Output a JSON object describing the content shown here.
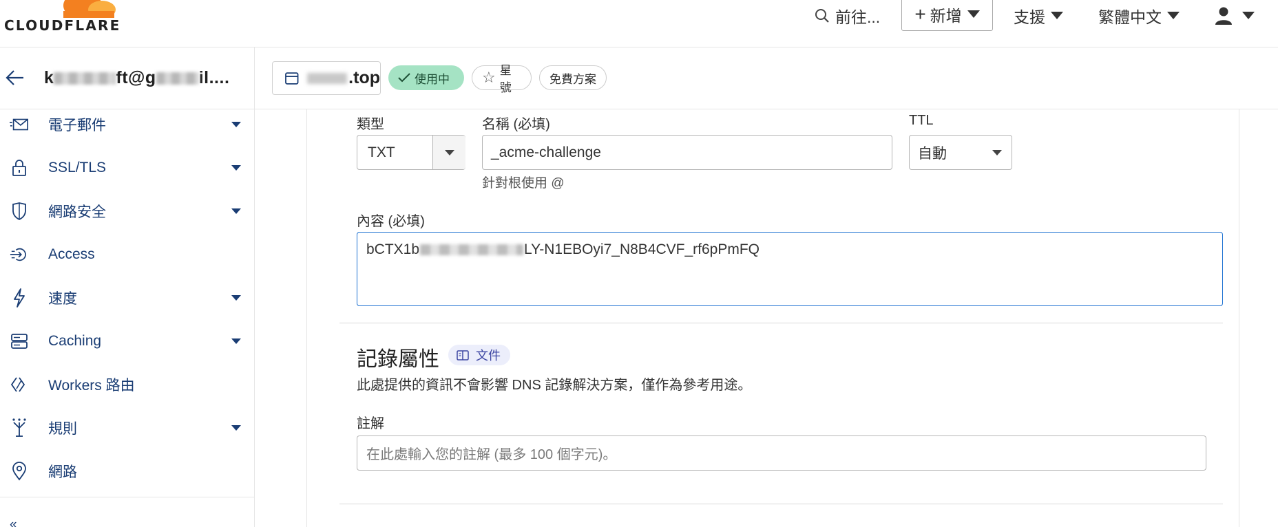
{
  "header": {
    "brand": "CLOUDFLARE",
    "goto_label": "前往...",
    "add_label": "新增",
    "support_label": "支援",
    "language_label": "繁體中文",
    "colors": {
      "brand_orange": "#f38020"
    }
  },
  "account": {
    "email_prefix": "k",
    "email_suffix": "ft@g",
    "email_tail": "il...."
  },
  "zone": {
    "domain_suffix": ".top",
    "status": "使用中",
    "star_label": "星號",
    "plan": "免費方案"
  },
  "sidebar": {
    "items": [
      {
        "icon": "email-icon",
        "label": "電子郵件",
        "expandable": true
      },
      {
        "icon": "lock-icon",
        "label": "SSL/TLS",
        "expandable": true
      },
      {
        "icon": "shield-icon",
        "label": "網路安全",
        "expandable": true
      },
      {
        "icon": "access-icon",
        "label": "Access",
        "expandable": false
      },
      {
        "icon": "lightning-icon",
        "label": "速度",
        "expandable": true
      },
      {
        "icon": "server-icon",
        "label": "Caching",
        "expandable": true
      },
      {
        "icon": "workers-icon",
        "label": "Workers 路由",
        "expandable": false
      },
      {
        "icon": "rules-icon",
        "label": "規則",
        "expandable": true
      },
      {
        "icon": "location-pin-icon",
        "label": "網路",
        "expandable": false
      }
    ]
  },
  "form": {
    "type_label": "類型",
    "type_value": "TXT",
    "name_label": "名稱 (必填)",
    "name_value": "_acme-challenge",
    "name_hint": "針對根使用 @",
    "ttl_label": "TTL",
    "ttl_value": "自動",
    "content_label": "內容 (必填)",
    "content_prefix": "bCTX1b",
    "content_suffix": "LY-N1EBOyi7_N8B4CVF_rf6pPmFQ"
  },
  "attributes": {
    "title": "記錄屬性",
    "doc_label": "文件",
    "description": "此處提供的資訊不會影響 DNS 記錄解決方案，僅作為參考用途。",
    "comment_label": "註解",
    "comment_placeholder": "在此處輸入您的註解 (最多 100 個字元)。"
  }
}
